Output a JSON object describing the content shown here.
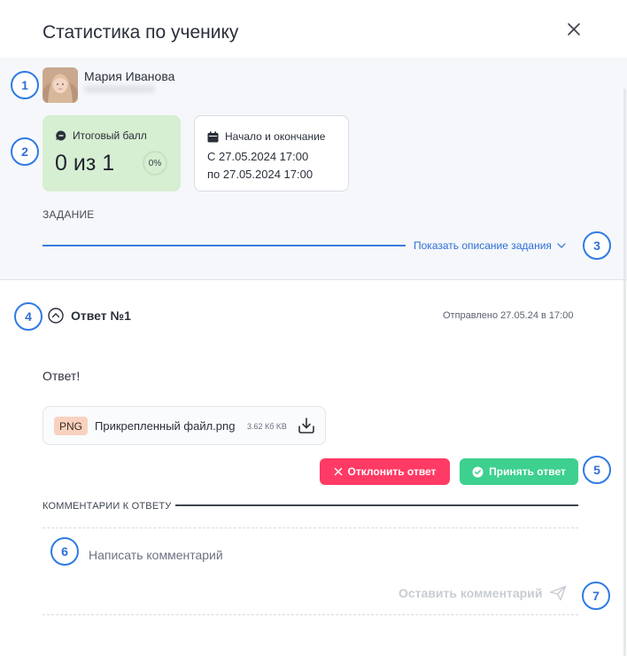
{
  "modal": {
    "title": "Статистика по ученику",
    "close_icon": "close-icon"
  },
  "student": {
    "name": "Мария Иванова",
    "avatar_icon": "avatar"
  },
  "score": {
    "label": "Итоговый балл",
    "value": "0 из 1",
    "percent": "0%",
    "icon": "chat-bubble-icon"
  },
  "dates": {
    "label": "Начало и окончание",
    "start": "С 27.05.2024 17:00",
    "end": "по 27.05.2024 17:00",
    "icon": "calendar-icon"
  },
  "task": {
    "label": "ЗАДАНИЕ",
    "show_description": "Показать описание задания"
  },
  "answer": {
    "title": "Ответ №1",
    "sent": "Отправлено 27.05.24 в 17:00",
    "text": "Ответ!",
    "file": {
      "ext": "PNG",
      "name": "Прикрепленный файл.png",
      "size": "3.62 Кб KB"
    },
    "reject_label": "Отклонить ответ",
    "accept_label": "Принять ответ"
  },
  "comments": {
    "label": "КОММЕНТАРИИ К ОТВЕТУ",
    "placeholder": "Написать комментарий",
    "submit_label": "Оставить комментарий"
  },
  "markers": [
    "1",
    "2",
    "3",
    "4",
    "5",
    "6",
    "7"
  ],
  "colors": {
    "accent": "#2f6fd8",
    "score_bg": "#d6eed1",
    "reject": "#ff3a65",
    "accept": "#3dd08f"
  }
}
